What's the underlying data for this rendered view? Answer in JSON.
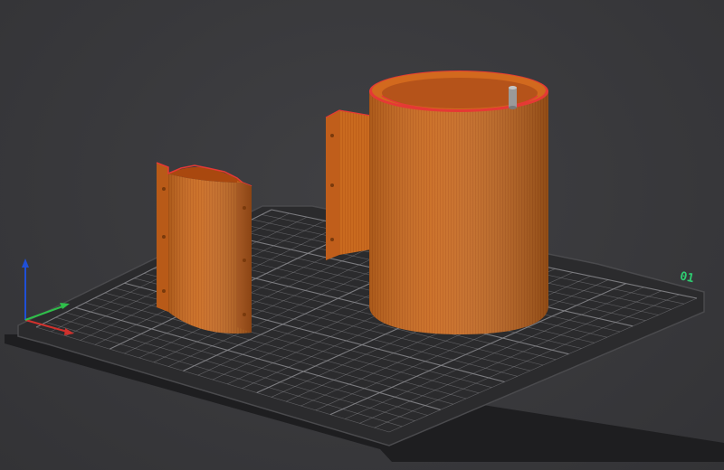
{
  "viewport": {
    "background_color": "#3a3a3d",
    "bed": {
      "plate_label": "01",
      "plate_label_color": "#2ecc71",
      "surface_color": "#2b2b2d",
      "grid_color": "#8a8a8e",
      "grid_cells": 24
    },
    "axes": {
      "x_color": "#d0312d",
      "y_color": "#2fbf4a",
      "z_color": "#1f4fd6"
    },
    "objects": [
      {
        "name": "small-half-shell",
        "color": "#c9611a",
        "edge_color": "#e53935"
      },
      {
        "name": "flanged-half-shell",
        "color": "#c9611a",
        "edge_color": "#e53935"
      },
      {
        "name": "large-cylinder",
        "color": "#c9611a",
        "edge_color": "#e53935",
        "pin_color": "#9a9a9a"
      }
    ]
  }
}
